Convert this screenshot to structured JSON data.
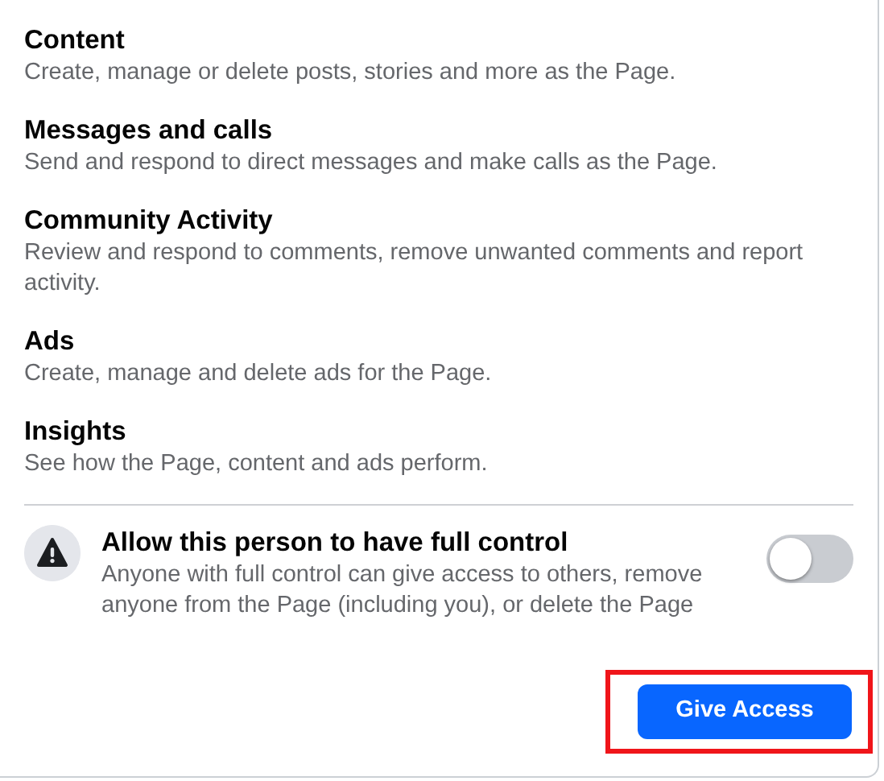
{
  "permissions": [
    {
      "title": "Content",
      "description": "Create, manage or delete posts, stories and more as the Page."
    },
    {
      "title": "Messages and calls",
      "description": "Send and respond to direct messages and make calls as the Page."
    },
    {
      "title": "Community Activity",
      "description": "Review and respond to comments, remove unwanted comments and report activity."
    },
    {
      "title": "Ads",
      "description": "Create, manage and delete ads for the Page."
    },
    {
      "title": "Insights",
      "description": "See how the Page, content and ads perform."
    }
  ],
  "full_control": {
    "title": "Allow this person to have full control",
    "description": "Anyone with full control can give access to others, remove anyone from the Page (including you), or delete the Page",
    "on": false
  },
  "button": {
    "label": "Give Access",
    "highlighted": true
  }
}
